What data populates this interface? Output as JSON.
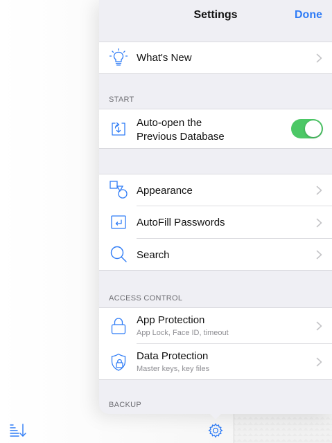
{
  "popover": {
    "title": "Settings",
    "done_label": "Done"
  },
  "rows": {
    "whats_new": {
      "label": "What's New"
    },
    "auto_open": {
      "label_line1": "Auto-open the",
      "label_line2": "Previous Database",
      "toggle_on": true
    },
    "appearance": {
      "label": "Appearance"
    },
    "autofill": {
      "label": "AutoFill Passwords"
    },
    "search": {
      "label": "Search"
    },
    "app_protection": {
      "label": "App Protection",
      "sub": "App Lock, Face ID, timeout"
    },
    "data_protection": {
      "label": "Data Protection",
      "sub": "Master keys, key files"
    }
  },
  "sections": {
    "start": "START",
    "access_control": "ACCESS CONTROL",
    "backup": "BACKUP"
  },
  "colors": {
    "accent": "#2f7cf6",
    "toggle_on": "#4cc866",
    "icon": "#2f7cf6"
  },
  "icons": {
    "whats_new": "lightbulb-icon",
    "auto_open": "auto-open-icon",
    "appearance": "shapes-icon",
    "autofill": "autofill-icon",
    "search": "search-icon",
    "app_protection": "lock-icon",
    "data_protection": "shield-lock-icon",
    "sort": "sort-icon",
    "settings": "gear-icon",
    "chevron": "chevron-right-icon"
  }
}
